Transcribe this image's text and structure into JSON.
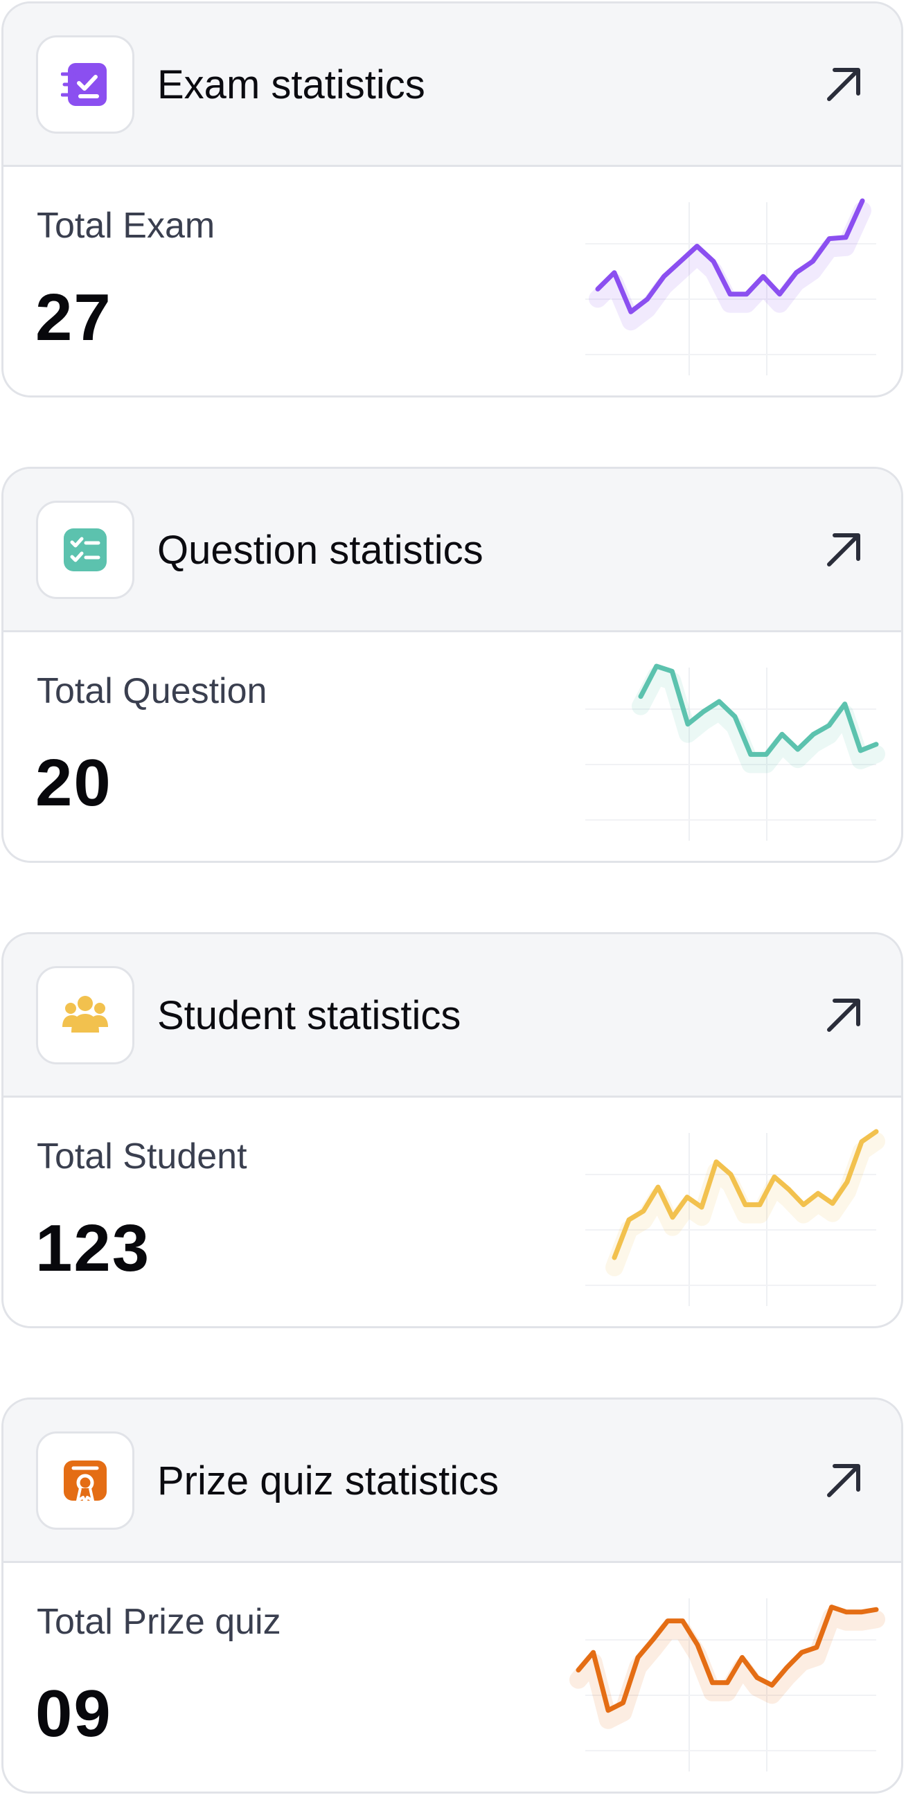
{
  "cards": [
    {
      "title": "Exam statistics",
      "metric_label": "Total Exam",
      "metric_value": "27",
      "icon": "exam-checklist-icon",
      "color": "#8b4ff0",
      "sparkline": [
        0.3,
        0.43,
        0.12,
        0.22,
        0.4,
        0.52,
        0.64,
        0.52,
        0.26,
        0.26,
        0.4,
        0.26,
        0.43,
        0.52,
        0.7,
        0.71,
        1.0
      ]
    },
    {
      "title": "Question statistics",
      "metric_label": "Total Question",
      "metric_value": "20",
      "icon": "question-list-icon",
      "color": "#5cc2ae",
      "sparkline": [
        0.76,
        1.0,
        0.96,
        0.54,
        0.64,
        0.72,
        0.6,
        0.3,
        0.3,
        0.46,
        0.34,
        0.46,
        0.53,
        0.7,
        0.33,
        0.38
      ]
    },
    {
      "title": "Student statistics",
      "metric_label": "Total Student",
      "metric_value": "123",
      "icon": "students-group-icon",
      "color": "#f2c14e",
      "sparkline": [
        0.0,
        0.3,
        0.37,
        0.56,
        0.32,
        0.48,
        0.4,
        0.76,
        0.66,
        0.42,
        0.42,
        0.64,
        0.54,
        0.42,
        0.51,
        0.43,
        0.6,
        0.92,
        1.0
      ]
    },
    {
      "title": "Prize quiz statistics",
      "metric_label": "Total Prize quiz",
      "metric_value": "09",
      "icon": "prize-award-icon",
      "color": "#e46d14",
      "sparkline": [
        0.42,
        0.56,
        0.1,
        0.16,
        0.52,
        0.66,
        0.81,
        0.81,
        0.62,
        0.32,
        0.32,
        0.52,
        0.36,
        0.3,
        0.44,
        0.56,
        0.6,
        0.92,
        0.88,
        0.88,
        0.9
      ]
    }
  ],
  "arrow_icon": "arrow-up-right-icon"
}
